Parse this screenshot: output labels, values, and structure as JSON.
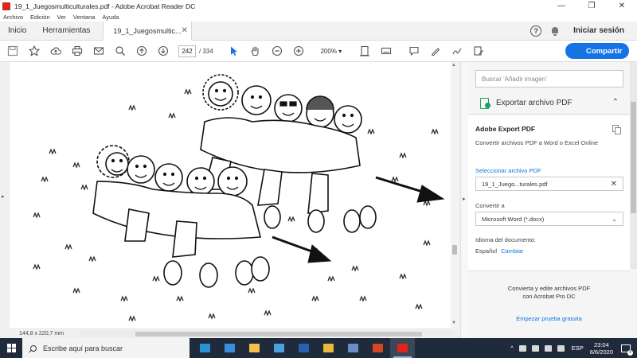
{
  "window": {
    "title": "19_1_Juegosmulticulturales.pdf - Adobe Acrobat Reader DC",
    "minimize": "—",
    "maximize": "❐",
    "close": "✕"
  },
  "menu": [
    "Archivo",
    "Edición",
    "Ver",
    "Ventana",
    "Ayuda"
  ],
  "tabs": {
    "home": "Inicio",
    "tools": "Herramientas",
    "document": "19_1_Juegosmultic...",
    "help": "?",
    "signin": "Iniciar sesión"
  },
  "toolbar": {
    "current_page": "242",
    "page_sep": "/",
    "total_pages": "334",
    "zoom": "200%",
    "share_label": "Compartir"
  },
  "status": {
    "dimensions": "144,8 x 220,7 mm"
  },
  "right_pane": {
    "search_placeholder": "Buscar 'Añadir imagen'",
    "export_header": "Exportar archivo PDF",
    "card_title": "Adobe Export PDF",
    "card_desc": "Convertir archivos PDF a Word o Excel Online",
    "select_file_link": "Seleccionar archivo PDF",
    "file_name": "19_1_Juego...turales.pdf",
    "convert_label": "Convertir a",
    "convert_value": "Microsoft Word (*.docx)",
    "lang_label": "Idioma del documento:",
    "lang_value": "Español",
    "lang_change": "Cambiar",
    "promo_line1": "Convierta y edite archivos PDF",
    "promo_line2": "con Acrobat Pro DC",
    "trial": "Empezar prueba gratuita"
  },
  "taskbar": {
    "search_placeholder": "Escribe aquí para buscar",
    "apps": [
      {
        "name": "edge-icon",
        "color": "#2b8fd6"
      },
      {
        "name": "mail-icon",
        "color": "#3b8ede"
      },
      {
        "name": "file-explorer-icon",
        "color": "#f2c14e"
      },
      {
        "name": "store-icon",
        "color": "#4aa3df"
      },
      {
        "name": "word-icon",
        "color": "#2b5fb4"
      },
      {
        "name": "chrome-icon",
        "color": "#e8b93a"
      },
      {
        "name": "photos-icon",
        "color": "#6a8fc7"
      },
      {
        "name": "powerpoint-icon",
        "color": "#d24726"
      },
      {
        "name": "acrobat-icon",
        "color": "#e1251b"
      }
    ],
    "lang": "ESP",
    "time": "23:04",
    "date": "6/6/2020",
    "notification_count": "4"
  }
}
